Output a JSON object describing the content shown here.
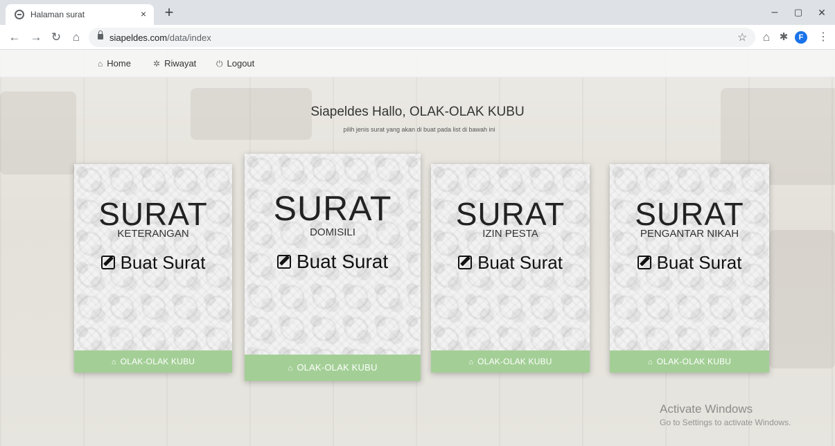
{
  "browser": {
    "tab_title": "Halaman surat",
    "tab_close": "×",
    "new_tab": "+",
    "url_domain": "siapeldes.com",
    "url_path": "/data/index",
    "profile_initial": "F",
    "window_controls": [
      "–",
      "▢",
      "✕"
    ],
    "icons": {
      "back": "back-arrow-icon",
      "forward": "forward-arrow-icon",
      "reload": "reload-icon",
      "home": "home-icon",
      "lock": "lock-icon",
      "star": "star-icon",
      "extensions": "puzzle-icon",
      "menu": "kebab-menu-icon"
    },
    "accent": "#1a73e8"
  },
  "navbar": {
    "items": [
      {
        "label": "Home",
        "icon": "home-icon"
      },
      {
        "label": "Riwayat",
        "icon": "gear-icon"
      },
      {
        "label": "Logout",
        "icon": "power-icon"
      }
    ]
  },
  "hero": {
    "title": "Siapeldes Hallo, OLAK-OLAK KUBU",
    "subtitle": "pilih jenis surat yang akan di buat pada list di bawah ini"
  },
  "cards": [
    {
      "title": "SURAT",
      "subtitle": "KETERANGAN",
      "action": "Buat Surat",
      "footer": "OLAK-OLAK KUBU"
    },
    {
      "title": "SURAT",
      "subtitle": "DOMISILI",
      "action": "Buat Surat",
      "footer": "OLAK-OLAK KUBU"
    },
    {
      "title": "SURAT",
      "subtitle": "IZIN PESTA",
      "action": "Buat Surat",
      "footer": "OLAK-OLAK KUBU"
    },
    {
      "title": "SURAT",
      "subtitle": "PENGANTAR NIKAH",
      "action": "Buat Surat",
      "footer": "OLAK-OLAK KUBU"
    }
  ],
  "card_footer_color": "#a3cf96",
  "watermark": {
    "title": "Activate Windows",
    "subtitle": "Go to Settings to activate Windows."
  }
}
